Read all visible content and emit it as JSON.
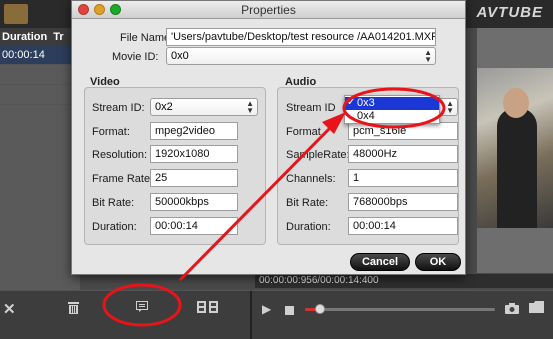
{
  "app": {
    "brand": "AVTUBE",
    "list_header": [
      "Duration",
      "Tr"
    ],
    "selected_row_duration": "00:00:14",
    "timeline": "00:00:00:956/00:00:14:400"
  },
  "dialog": {
    "title": "Properties",
    "file_name_label": "File Name:",
    "file_name_value": "'Users/pavtube/Desktop/test resource /AA014201.MXF",
    "movie_id_label": "Movie ID:",
    "movie_id_value": "0x0",
    "video": {
      "title": "Video",
      "stream_id_label": "Stream ID:",
      "stream_id_value": "0x2",
      "format_label": "Format:",
      "format_value": "mpeg2video",
      "resolution_label": "Resolution:",
      "resolution_value": "1920x1080",
      "frame_rate_label": "Frame Rate:",
      "frame_rate_value": "25",
      "bit_rate_label": "Bit Rate:",
      "bit_rate_value": "50000kbps",
      "duration_label": "Duration:",
      "duration_value": "00:00:14"
    },
    "audio": {
      "title": "Audio",
      "stream_id_label": "Stream ID",
      "format_label": "Format",
      "format_value": "pcm_s16le",
      "sample_rate_label": "SampleRate:",
      "sample_rate_value": "48000Hz",
      "channels_label": "Channels:",
      "channels_value": "1",
      "bit_rate_label": "Bit Rate:",
      "bit_rate_value": "768000bps",
      "duration_label": "Duration:",
      "duration_value": "00:00:14"
    },
    "stream_dropdown": {
      "options": [
        "0x3",
        "0x4"
      ],
      "check": "✓"
    },
    "cancel_label": "Cancel",
    "ok_label": "OK"
  },
  "colors": {
    "annotation": "#e8141a",
    "selection": "#1b38d6"
  },
  "icons": [
    "close-icon",
    "trash-icon",
    "properties-icon",
    "film-merge-icon",
    "play-icon",
    "stop-icon",
    "snapshot-icon",
    "folder-icon"
  ]
}
